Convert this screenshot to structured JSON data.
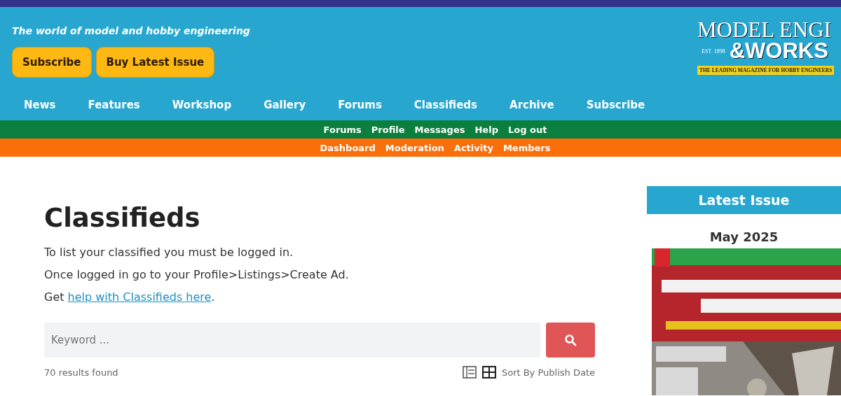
{
  "header": {
    "tagline": "The world of model and hobby engineering",
    "buttons": [
      "Subscribe",
      "Buy Latest Issue"
    ],
    "logo": {
      "title": "MODEL ENGI",
      "est": "EST. 1898",
      "subtitle": "&WORKS",
      "strap": "THE LEADING MAGAZINE FOR HOBBY ENGINEERS"
    }
  },
  "main_nav": [
    "News",
    "Features",
    "Workshop",
    "Gallery",
    "Forums",
    "Classifieds",
    "Archive",
    "Subscribe"
  ],
  "forum_nav": [
    "Forums",
    "Profile",
    "Messages",
    "Help",
    "Log out"
  ],
  "admin_nav": [
    "Dashboard",
    "Moderation",
    "Activity",
    "Members"
  ],
  "page": {
    "title": "Classifieds",
    "lines": [
      "To list your classified you must be logged in.",
      "Once logged in go to your Profile>Listings>Create Ad."
    ],
    "help": {
      "prefix": "Get ",
      "link": "help with Classifieds here",
      "suffix": "."
    },
    "search": {
      "placeholder": "Keyword ..."
    },
    "results": "70 results found",
    "sort": "Sort By Publish Date"
  },
  "sidebar": {
    "heading": "Latest Issue",
    "issue": "May 2025"
  }
}
